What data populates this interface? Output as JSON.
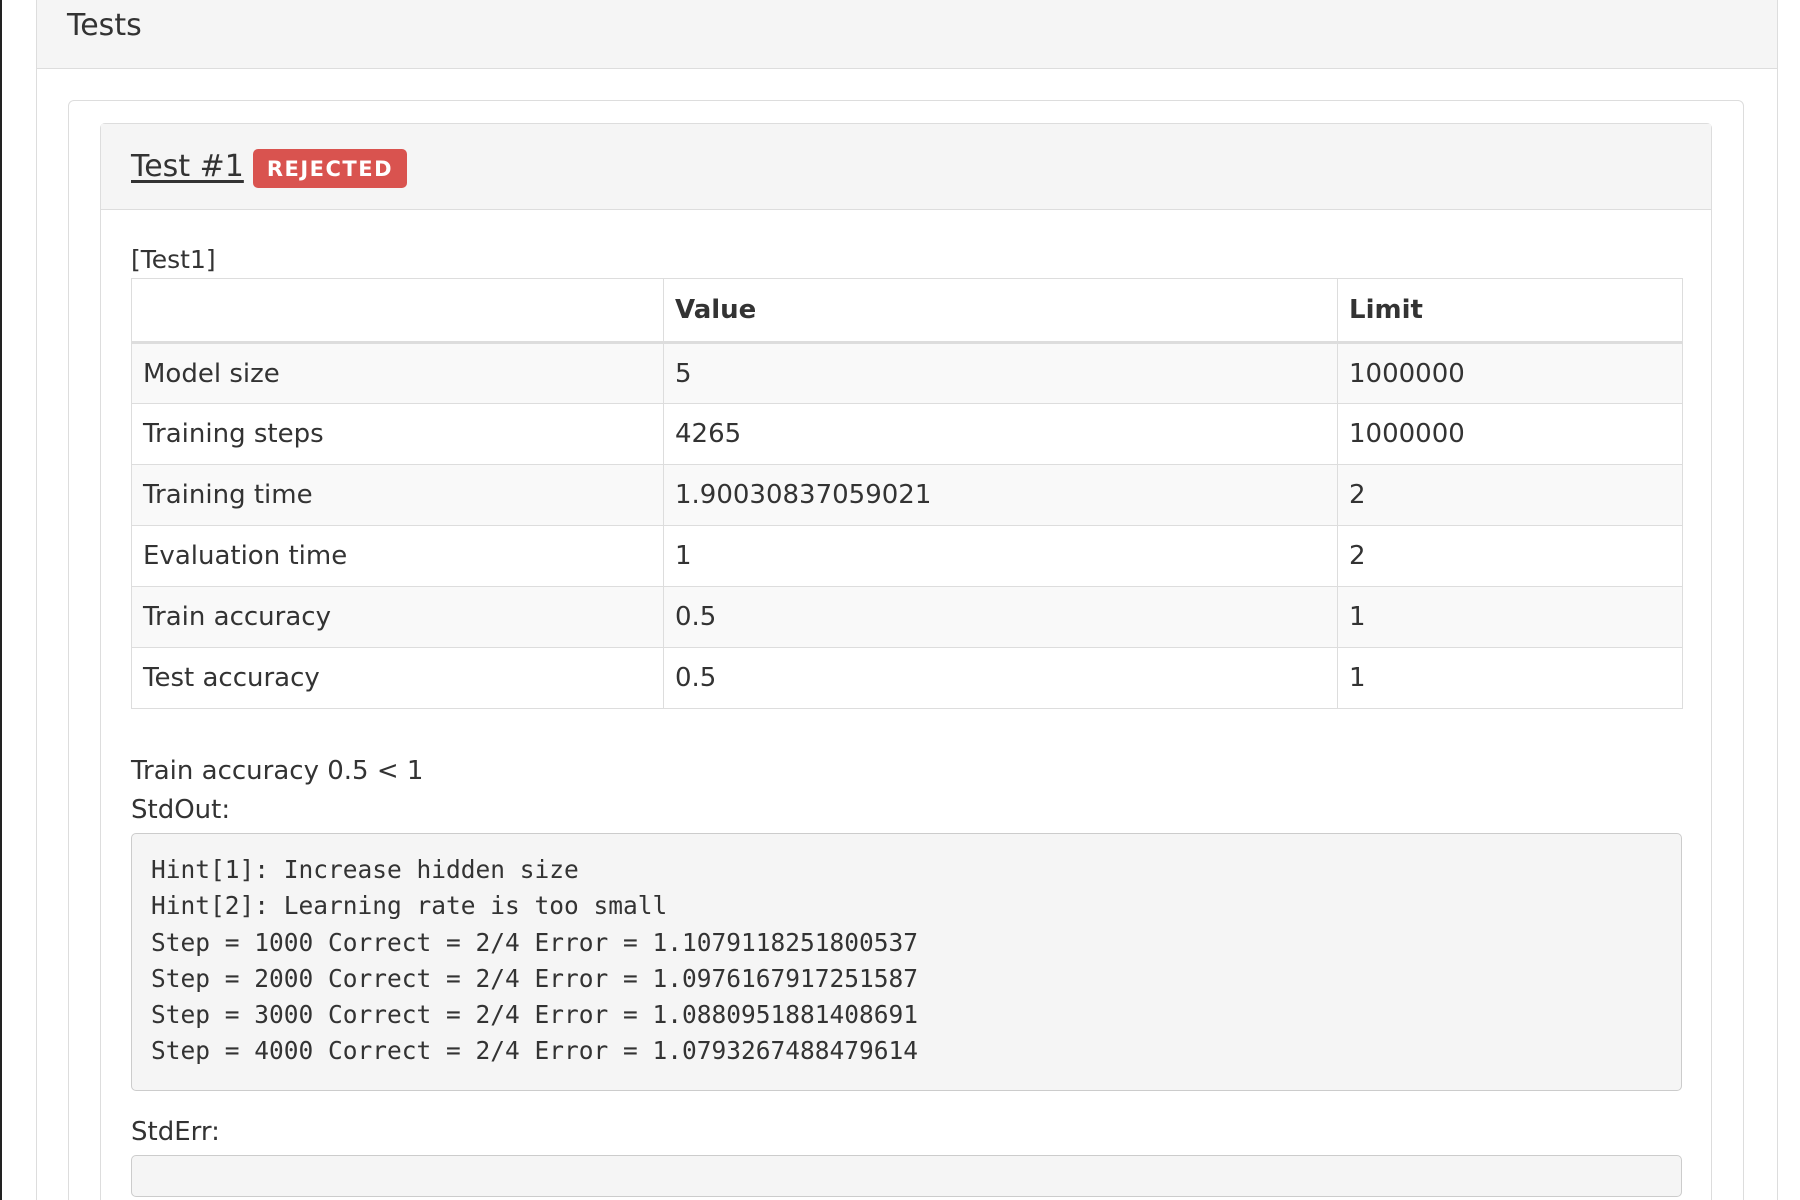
{
  "panel": {
    "title": "Tests"
  },
  "test": {
    "title": "Test #1",
    "status": "REJECTED",
    "status_color": "#d9534f",
    "name": "[Test1]",
    "table": {
      "headers": [
        "",
        "Value",
        "Limit"
      ],
      "rows": [
        {
          "metric": "Model size",
          "value": "5",
          "limit": "1000000"
        },
        {
          "metric": "Training steps",
          "value": "4265",
          "limit": "1000000"
        },
        {
          "metric": "Training time",
          "value": "1.90030837059021",
          "limit": "2"
        },
        {
          "metric": "Evaluation time",
          "value": "1",
          "limit": "2"
        },
        {
          "metric": "Train accuracy",
          "value": "0.5",
          "limit": "1"
        },
        {
          "metric": "Test accuracy",
          "value": "0.5",
          "limit": "1"
        }
      ]
    },
    "reason": "Train accuracy 0.5 < 1",
    "stdout_label": "StdOut:",
    "stdout_lines": [
      "Hint[1]: Increase hidden size",
      "Hint[2]: Learning rate is too small",
      "Step = 1000 Correct = 2/4 Error = 1.1079118251800537",
      "Step = 2000 Correct = 2/4 Error = 1.0976167917251587",
      "Step = 3000 Correct = 2/4 Error = 1.0880951881408691",
      "Step = 4000 Correct = 2/4 Error = 1.0793267488479614"
    ],
    "stderr_label": "StdErr:",
    "stderr": ""
  }
}
